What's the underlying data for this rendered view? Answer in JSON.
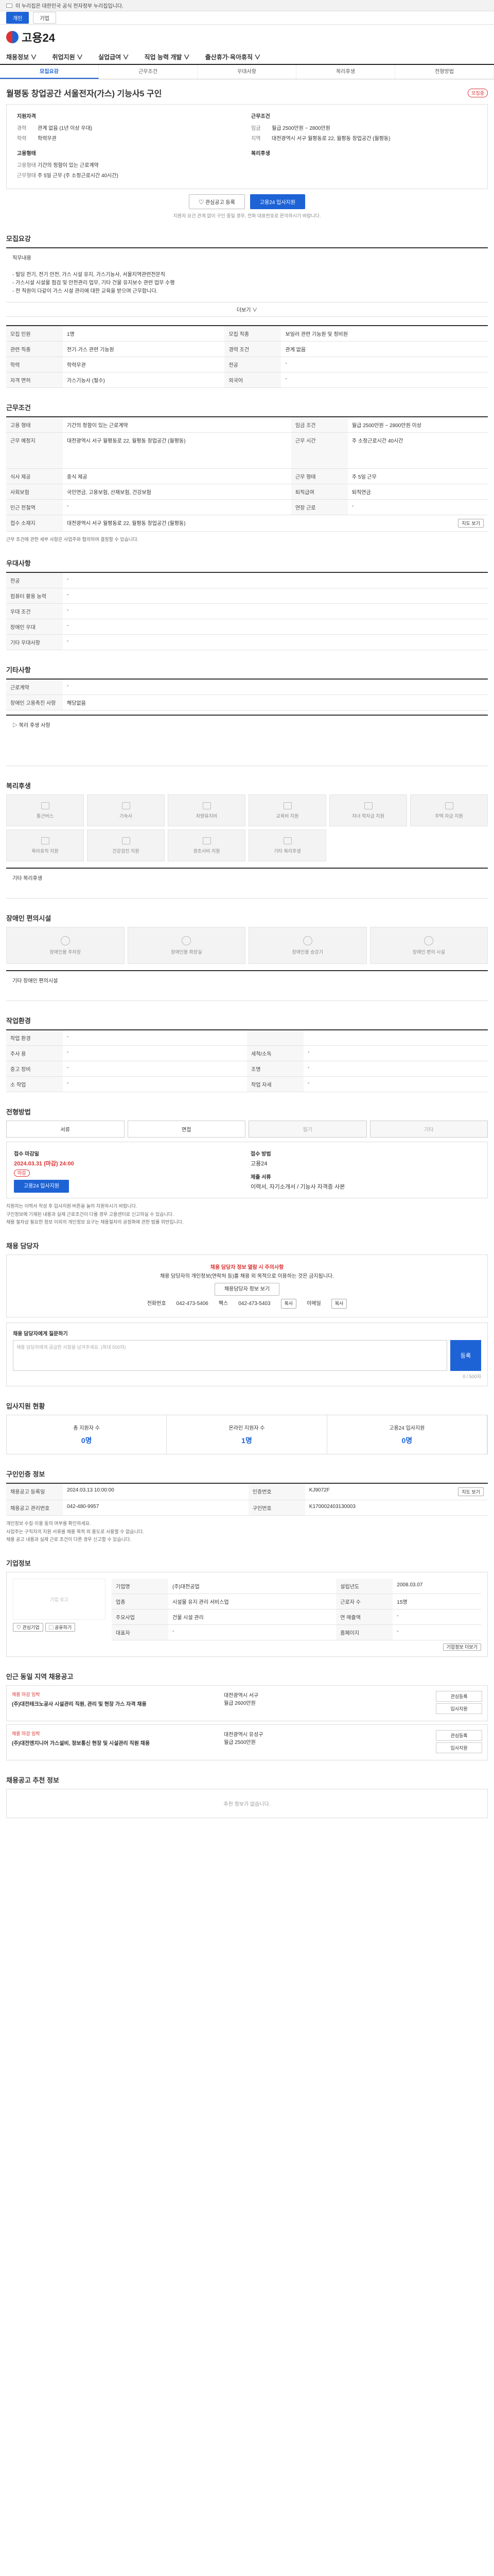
{
  "gov_bar": {
    "text": "이 누리집은 대한민국 공식 전자정부 누리집입니다."
  },
  "top_tabs": [
    "개인",
    "기업"
  ],
  "logo": {
    "text": "고용24"
  },
  "gnb": [
    "채용정보 ∨",
    "취업지원 ∨",
    "실업급여 ∨",
    "직업 능력 개발 ∨",
    "출산휴가·육아휴직 ∨"
  ],
  "subtabs": [
    "모집요강",
    "근무조건",
    "우대사항",
    "복리후생",
    "전형방법"
  ],
  "job": {
    "title": "월평동 창업공간 서울전자(가스) 기능사5 구인",
    "badge": "모집중",
    "left_head": "지원자격",
    "left_kv": [
      [
        "경력",
        "관계 없음 (1년 이상 우대)"
      ],
      [
        "학력",
        "학력무관"
      ]
    ],
    "left_head2": "고용형태",
    "left_kv2": [
      [
        "고용형태",
        "기간의 정함이 있는 근로계약"
      ],
      [
        "근무형태",
        "주 5일 근무 (주 소정근로시간 40시간)"
      ]
    ],
    "right_head": "근무조건",
    "right_kv": [
      [
        "임금",
        "월급 2500만원 ~ 2800만원"
      ],
      [
        "지역",
        "대전광역시 서구 월평동로 22, 월평동 창업공간 (월평동)"
      ]
    ],
    "right_head2": "복리후생"
  },
  "buttons": {
    "bookmark": "♡ 관심공고 등록",
    "apply": "고용24 입사지원"
  },
  "note_center": "지원자 요건 관계 없이 구인 중일 경우, 전화 대표번호로 문의하시기 바랍니다.",
  "recruit": {
    "heading": "모집요강",
    "body": "직무내용\n\n- 빌딩 전기, 전기 안전, 가스 시설 유지, 가스기능사, 서울지역관련전문직\n- 가스시설 시설물 점검 및 안전관리 업무, 기타 건물 유지보수 관련 업무 수행\n- 전 직원이 다같이 가스 시설 관리에 대한 교육을 받으며 근무합니다.",
    "more": "더보기 ∨",
    "rows": [
      [
        [
          "모집 인원",
          "1명"
        ],
        [
          "모집 직종",
          "보일러 관련 기능원 및 정비원"
        ]
      ],
      [
        [
          "관련 직종",
          "전기·가스 관련 기능원"
        ],
        [
          "경력 조건",
          "관계 없음"
        ]
      ],
      [
        [
          "학력",
          "학력무관"
        ],
        [
          "전공",
          "-"
        ]
      ],
      [
        [
          "자격 면허",
          "가스기능사 (필수)"
        ],
        [
          "외국어",
          "-"
        ]
      ]
    ]
  },
  "cond": {
    "heading": "근무조건",
    "rows": [
      [
        [
          "고용 형태",
          "기간의 정함이 있는 근로계약"
        ],
        [
          "임금 조건",
          "월급 2500만원 ~ 2800만원 이상"
        ]
      ],
      [
        [
          "근무 예정지",
          "대전광역시 서구 월평동로 22, 월평동 창업공간 (월평동)"
        ],
        [
          "근무 시간",
          "주 소정근로시간 40시간"
        ]
      ],
      [
        [
          "식사 제공",
          "중식 제공"
        ],
        [
          "근무 형태",
          "주 5일 근무"
        ]
      ],
      [
        [
          "사회보험",
          "국민연금, 고용보험, 산재보험, 건강보험"
        ],
        [
          "퇴직급여",
          "퇴직연금"
        ]
      ],
      [
        [
          "인근 전철역",
          "-"
        ],
        [
          "연장 근로",
          "-"
        ]
      ],
      [
        [
          "접수 소재지",
          "대전광역시 서구 월평동로 22, 월평동 창업공간 (월평동)"
        ],
        [
          "",
          ""
        ]
      ]
    ],
    "map_btn": "지도 보기",
    "foot": "근무 조건에 관한 세부 사항은 사업주와 협의하여 결정할 수 있습니다."
  },
  "pref": {
    "heading": "우대사항",
    "rows": [
      [
        "전공",
        "-"
      ],
      [
        "컴퓨터 활용 능력",
        "-"
      ],
      [
        "우대 조건",
        "-"
      ],
      [
        "장애인 우대",
        "-"
      ],
      [
        "기타 우대사항",
        "-"
      ]
    ]
  },
  "etc": {
    "heading": "기타사항",
    "rows": [
      [
        "근로계약",
        "-"
      ],
      [
        "장애인 고용촉진 사항",
        "해당없음"
      ]
    ],
    "box": "▷ 복리 후생 사항"
  },
  "welfare": {
    "heading": "복리후생",
    "items": [
      "통근버스",
      "기숙사",
      "차량유지비",
      "교육비 지원",
      "자녀 학자금 지원",
      "주택 자금 지원",
      "육아휴직 지원",
      "건강검진 지원",
      "경조사비 지원",
      "기타 복리후생"
    ],
    "extra_label": "기타 복리후생"
  },
  "disabled": {
    "heading": "장애인 편의시설",
    "items": [
      "장애인용 주차장",
      "장애인용 화장실",
      "장애인용 승강기",
      "장애인 편의 시설"
    ],
    "extra_label": "기타 장애인 편의시설"
  },
  "workplace": {
    "heading": "작업환경",
    "rows": [
      [
        [
          "작업 환경",
          "-"
        ],
        [
          "",
          ""
        ]
      ],
      [
        [
          "주사 용",
          "-"
        ],
        [
          "세척/소독",
          "-"
        ]
      ],
      [
        [
          "중고 장비",
          "-"
        ],
        [
          "조명",
          "-"
        ]
      ],
      [
        [
          "소 작업",
          "-"
        ],
        [
          "작업 자세",
          "-"
        ]
      ]
    ]
  },
  "selection": {
    "heading": "전형방법",
    "methods": [
      "서류",
      "면접",
      "필기",
      "기타"
    ],
    "deadline_label": "접수 마감일",
    "deadline": "2024.03.31 (마감) 24:00",
    "deadline_badge": "마감",
    "method_label": "접수 방법",
    "method_value": "고용24",
    "docs_label": "제출 서류",
    "docs_value": "이력서, 자기소개서 / 기능사 자격증 사본",
    "apply_btn": "고용24 입사지원",
    "bullets": [
      "지원자는 이력서 작성 후 입사지원 버튼을 눌러 지원하시기 바랍니다.",
      "구인정보에 기재된 내용과 실제 근로조건이 다를 경우 고용센터로 신고하실 수 있습니다.",
      "채용 절차상 필요한 정보 이외의 개인정보 요구는 채용절차의 공정화에 관한 법률 위반입니다."
    ]
  },
  "contact": {
    "heading": "채용 담당자",
    "alert_title": "채용 담당자 정보 열람 시 주의사항",
    "alert_body": "채용 담당자의 개인정보(연락처 등)를 채용 외 목적으로 이용하는 것은 금지됩니다.",
    "view_btn": "채용담당자 정보 보기",
    "phone_label": "전화번호",
    "phone": "042-473-5406",
    "fax_label": "팩스",
    "fax": "042-473-5403",
    "email_label": "이메일",
    "copy_btn": "복사",
    "copy_btn2": "복사",
    "cmt_title": "채용 담당자에게 질문하기",
    "cmt_ph": "채용 담당자에게 궁금한 사항을 남겨주세요. (최대 500자)",
    "cmt_count": "0 / 500자",
    "cmt_btn": "등록"
  },
  "status": {
    "heading": "입사지원 현황",
    "cells": [
      [
        "총 지원자 수",
        "0명"
      ],
      [
        "온라인 지원자 수",
        "1명"
      ],
      [
        "고용24 입사지원",
        "0명"
      ]
    ]
  },
  "reg": {
    "heading": "구인인증 정보",
    "rows": [
      [
        [
          "채용공고 등록일",
          "2024.03.13 10:00:00"
        ],
        [
          "인증번호",
          "KJ9072F"
        ]
      ],
      [
        [
          "채용공고 관리번호",
          "042-480-9957"
        ],
        [
          "구인번호",
          "K170002403130003"
        ]
      ]
    ],
    "bullets": [
      "개인정보 수집·이용 동의 여부를 확인하세요.",
      "사업주는 구직자의 지원 서류를 채용 목적 외 용도로 사용할 수 없습니다.",
      "채용 공고 내용과 실제 근로 조건이 다른 경우 신고할 수 있습니다."
    ],
    "map_btn": "지도 보기"
  },
  "company": {
    "heading": "기업정보",
    "logo_label": "기업 로고",
    "bookmark_btn": "♡ 관심기업",
    "share_btn": "▢ 공유하기",
    "rows": [
      [
        "기업명",
        "(주)대전공업"
      ],
      [
        "업종",
        "시설물 유지 관리 서비스업"
      ],
      [
        "근로자 수",
        "15명"
      ],
      [
        "주요사업",
        "건물 시설 관리"
      ],
      [
        "대표자",
        "-"
      ],
      [
        "설립년도",
        "2008.03.07"
      ],
      [
        "연 매출액",
        "-"
      ],
      [
        "홈페이지",
        "-"
      ]
    ],
    "detail_btn": "기업정보 더보기"
  },
  "related": {
    "heading": "인근 동일 지역 채용공고",
    "items": [
      {
        "name": "채용 마감 임박",
        "title": "(주)대전테크노공사 시설관리 직원, 관리 및 현장 가스 자격 채용",
        "loc": "대전광역시 서구",
        "pay": "월급 2600만원",
        "btn1": "관심등록",
        "btn2": "입사지원"
      },
      {
        "name": "채용 마감 임박",
        "title": "(주)대전엔지니어 가스설비, 정보통신 현장 및 시설관리 직원 채용",
        "loc": "대전광역시 유성구",
        "pay": "월급 2500만원",
        "btn1": "관심등록",
        "btn2": "입사지원"
      }
    ]
  },
  "recommend": {
    "heading": "채용공고 추천 정보",
    "empty": "추천 정보가 없습니다."
  }
}
